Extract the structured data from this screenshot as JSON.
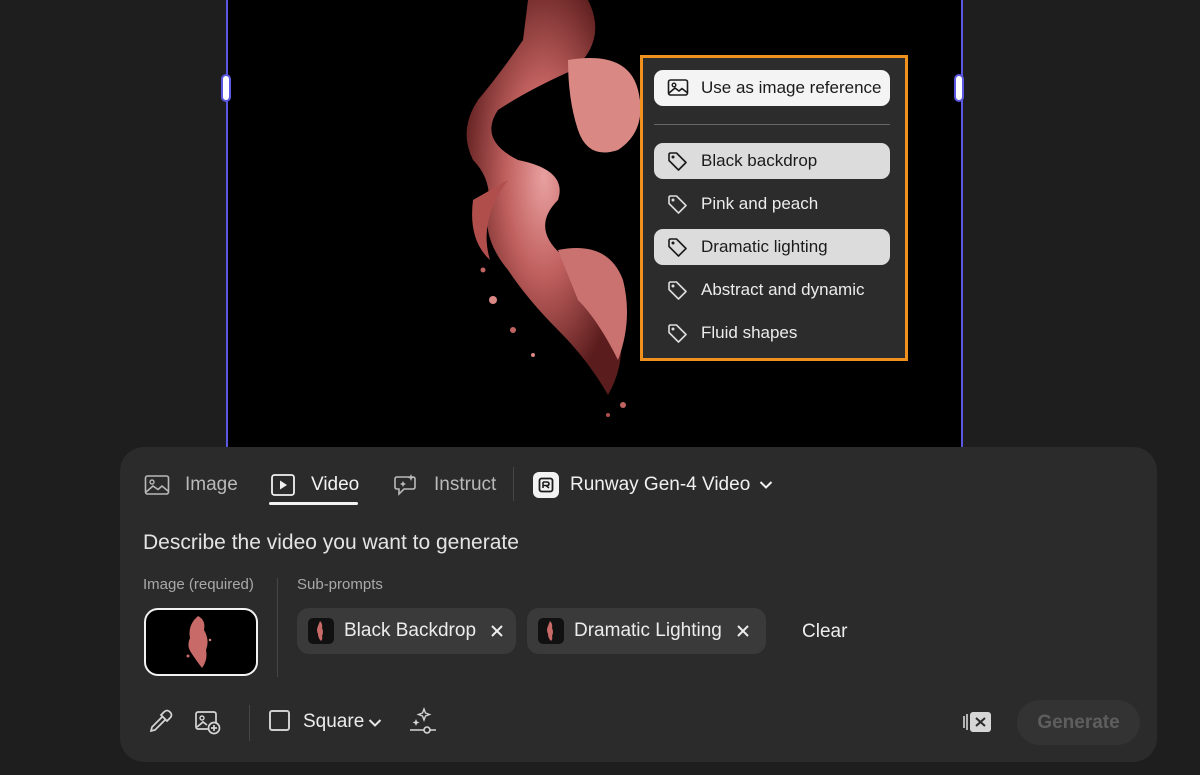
{
  "context_menu": {
    "reference_label": "Use as image reference",
    "items": [
      {
        "label": "Black backdrop"
      },
      {
        "label": "Pink and peach"
      },
      {
        "label": "Dramatic lighting"
      },
      {
        "label": "Abstract and dynamic"
      },
      {
        "label": "Fluid shapes"
      }
    ]
  },
  "tabs": [
    {
      "label": "Image"
    },
    {
      "label": "Video"
    },
    {
      "label": "Instruct"
    }
  ],
  "model": {
    "label": "Runway Gen-4 Video"
  },
  "prompt": {
    "placeholder": "Describe the video you want to generate"
  },
  "image_section": {
    "label": "Image (required)"
  },
  "subprompts": {
    "label": "Sub-prompts",
    "chips": [
      {
        "label": "Black Backdrop"
      },
      {
        "label": "Dramatic Lighting"
      }
    ],
    "clear_label": "Clear"
  },
  "toolbar": {
    "aspect_label": "Square",
    "generate_label": "Generate"
  },
  "colors": {
    "accent": "#5a57e0",
    "highlight_border": "#f0901e",
    "panel_bg": "#2b2b2b"
  }
}
